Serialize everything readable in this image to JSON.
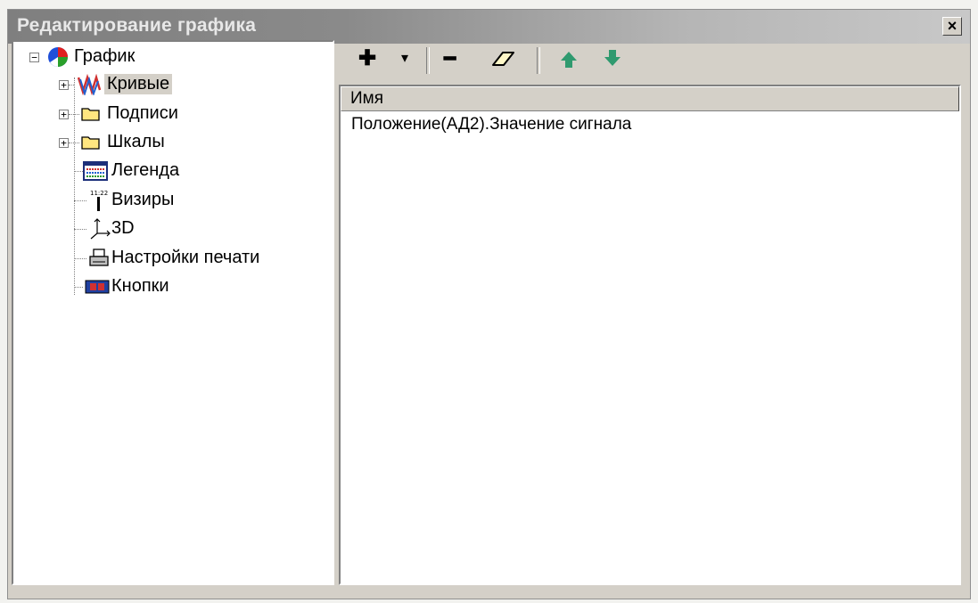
{
  "window": {
    "title": "Редактирование графика",
    "close_label": "×"
  },
  "tree": {
    "root": {
      "label": "График",
      "icon": "pie-chart-icon",
      "expander": "−"
    },
    "items": [
      {
        "label": "Кривые",
        "icon": "curves-icon",
        "expander": "+",
        "selected": true
      },
      {
        "label": "Подписи",
        "icon": "folder-icon",
        "expander": "+"
      },
      {
        "label": "Шкалы",
        "icon": "folder-icon",
        "expander": "+"
      },
      {
        "label": "Легенда",
        "icon": "legend-icon"
      },
      {
        "label": "Визиры",
        "icon": "sight-icon"
      },
      {
        "label": "3D",
        "icon": "axes-3d-icon"
      },
      {
        "label": "Настройки печати",
        "icon": "printer-icon"
      },
      {
        "label": "Кнопки",
        "icon": "buttons-icon"
      }
    ]
  },
  "toolbar": {
    "add": "✚",
    "dropdown": "▾",
    "remove": "━",
    "erase": "eraser-icon",
    "up": "up-arrow-icon",
    "down": "down-arrow-icon"
  },
  "list": {
    "column_header": "Имя",
    "rows": [
      "Положение(АД2).Значение сигнала"
    ]
  },
  "colors": {
    "window_bg": "#d4d0c8",
    "arrow_green": "#2f9a6f"
  }
}
